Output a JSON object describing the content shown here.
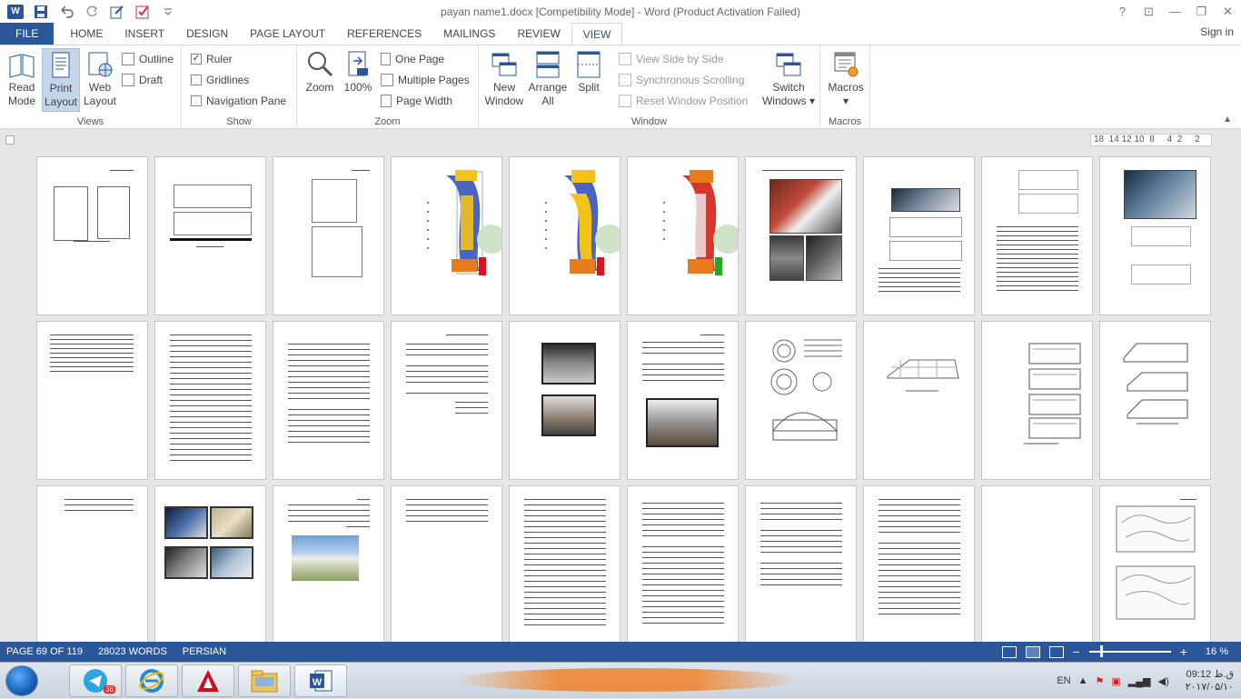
{
  "window": {
    "title": "payan name1.docx [Competibility Mode] - Word (Product Activation Failed)",
    "help": "?",
    "ribbon_display": "⊡",
    "minimize": "—",
    "restore": "❐",
    "close": "✕"
  },
  "tabs": [
    {
      "label": "FILE"
    },
    {
      "label": "HOME"
    },
    {
      "label": "INSERT"
    },
    {
      "label": "DESIGN"
    },
    {
      "label": "PAGE LAYOUT"
    },
    {
      "label": "REFERENCES"
    },
    {
      "label": "MAILINGS"
    },
    {
      "label": "REVIEW"
    },
    {
      "label": "VIEW"
    }
  ],
  "active_tab": "VIEW",
  "signin": "Sign in",
  "ribbon": {
    "views": {
      "label": "Views",
      "read_mode": [
        "Read",
        "Mode"
      ],
      "print_layout": [
        "Print",
        "Layout"
      ],
      "web_layout": [
        "Web",
        "Layout"
      ],
      "outline": "Outline",
      "draft": "Draft"
    },
    "show": {
      "label": "Show",
      "ruler": "Ruler",
      "ruler_checked": true,
      "gridlines": "Gridlines",
      "navigation_pane": "Navigation Pane"
    },
    "zoom": {
      "label": "Zoom",
      "zoom": "Zoom",
      "hundred": "100%",
      "one_page": "One Page",
      "multiple_pages": "Multiple Pages",
      "page_width": "Page Width"
    },
    "window": {
      "label": "Window",
      "new_window": [
        "New",
        "Window"
      ],
      "arrange_all": [
        "Arrange",
        "All"
      ],
      "split": "Split",
      "view_side_by_side": "View Side by Side",
      "synchronous_scrolling": "Synchronous Scrolling",
      "reset_window_position": "Reset Window Position",
      "switch_windows": [
        "Switch",
        "Windows ▾"
      ]
    },
    "macros": {
      "label": "Macros",
      "macros": "Macros",
      "arrow": "▾"
    }
  },
  "ruler": {
    "ticks": "18  14 12 10  8     4  2     2"
  },
  "statusbar": {
    "page": "PAGE 69 OF 119",
    "words": "28023 WORDS",
    "language": "PERSIAN",
    "zoom_percent": "16 %",
    "zoom_level": 0.16,
    "minus": "−",
    "plus": "+"
  },
  "taskbar": {
    "items": [
      "telegram",
      "internet-explorer",
      "autocad",
      "file-explorer",
      "word"
    ],
    "telegram_badge": "36",
    "language": "EN",
    "time": "09:12 ق.ظ",
    "date": "۲۰۱۷/۰۵/۱۰"
  },
  "colors": {
    "accent": "#2b579a",
    "ribbon_bg": "#ffffff",
    "doc_bg": "#e6e6e6"
  }
}
